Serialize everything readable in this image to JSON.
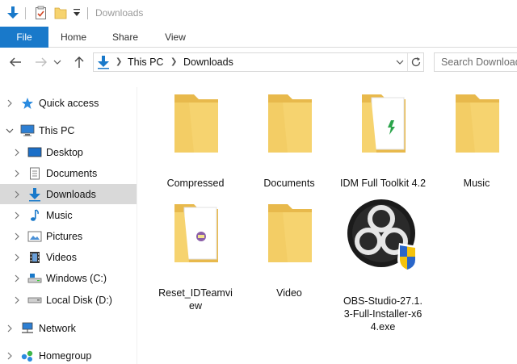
{
  "window": {
    "title": "Downloads"
  },
  "quick_access": {
    "icons": [
      "download-arrow-icon",
      "properties-checklist-icon",
      "new-folder-icon",
      "customize-dropdown-icon"
    ]
  },
  "ribbon": {
    "tabs": [
      {
        "label": "File",
        "active": true
      },
      {
        "label": "Home"
      },
      {
        "label": "Share"
      },
      {
        "label": "View"
      }
    ]
  },
  "address_bar": {
    "crumbs": [
      "This PC",
      "Downloads"
    ]
  },
  "search": {
    "placeholder": "Search Downloads"
  },
  "sidebar": {
    "items": [
      {
        "label": "Quick access",
        "icon": "star-icon"
      },
      {
        "label": "This PC",
        "icon": "monitor-icon",
        "expanded": true
      },
      {
        "label": "Desktop",
        "icon": "desktop-icon"
      },
      {
        "label": "Documents",
        "icon": "documents-icon"
      },
      {
        "label": "Downloads",
        "icon": "downloads-icon",
        "selected": true
      },
      {
        "label": "Music",
        "icon": "music-note-icon"
      },
      {
        "label": "Pictures",
        "icon": "pictures-icon"
      },
      {
        "label": "Videos",
        "icon": "film-icon"
      },
      {
        "label": "Windows (C:)",
        "icon": "system-drive-icon"
      },
      {
        "label": "Local Disk (D:)",
        "icon": "local-disk-icon"
      },
      {
        "label": "Network",
        "icon": "network-icon"
      },
      {
        "label": "Homegroup",
        "icon": "homegroup-icon"
      }
    ]
  },
  "files": [
    {
      "name": "Compressed",
      "type": "folder"
    },
    {
      "name": "Documents",
      "type": "folder"
    },
    {
      "name": "IDM Full Toolkit 4.2",
      "type": "folder-with-file"
    },
    {
      "name": "Music",
      "type": "folder"
    },
    {
      "name": "Reset_IDTeamview",
      "type": "folder-with-file"
    },
    {
      "name": "Video",
      "type": "folder"
    },
    {
      "name": "OBS-Studio-27.1.3-Full-Installer-x64.exe",
      "type": "installer"
    }
  ],
  "colors": {
    "accent": "#1979ca",
    "folder": "#f6d36f",
    "folder_dark": "#e8b94c",
    "selected_row": "#d9d9d9"
  }
}
